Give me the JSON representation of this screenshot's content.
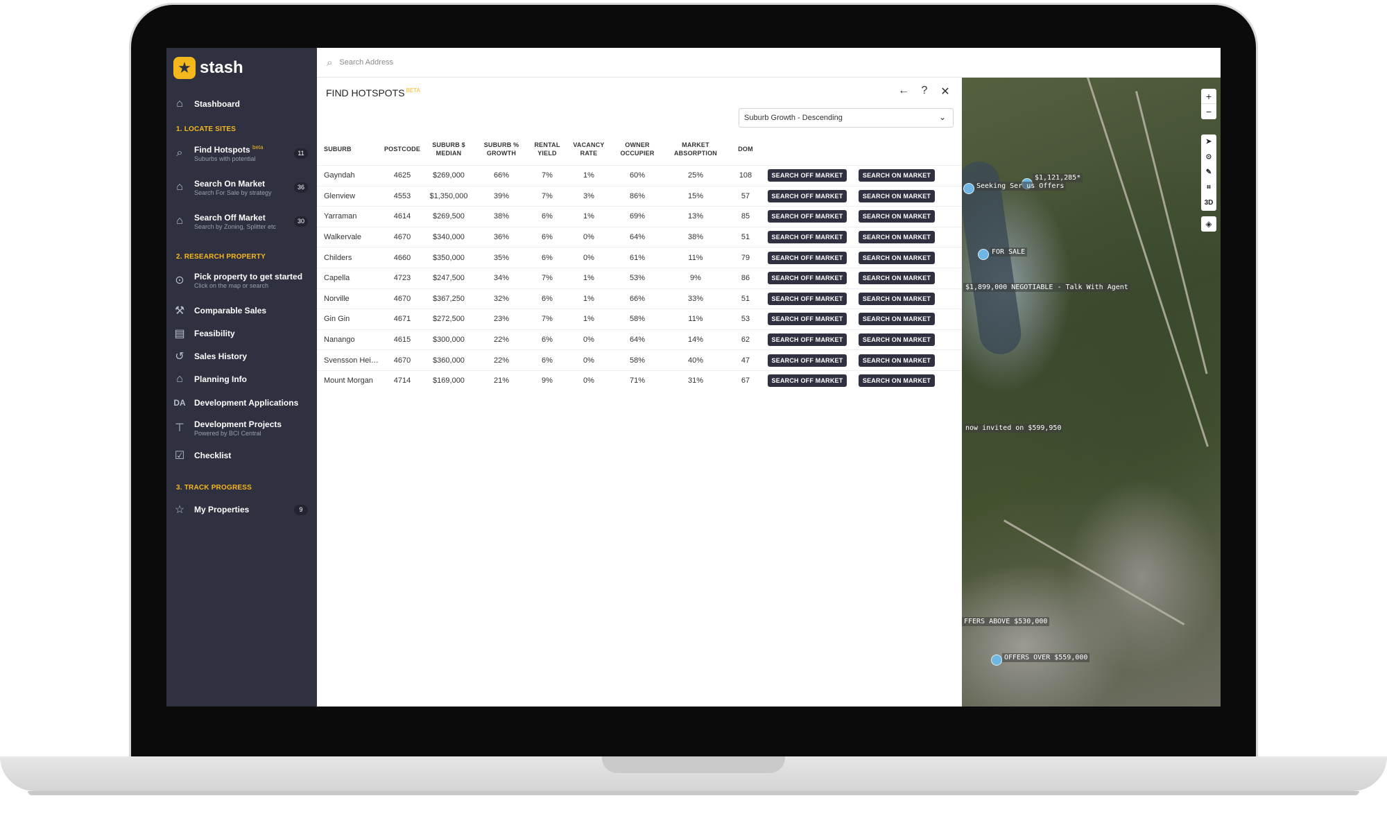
{
  "brand": {
    "name": "stash",
    "logo_icon": "star-icon"
  },
  "sidebar": {
    "stashboard": "Stashboard",
    "sections": [
      "1. LOCATE SITES",
      "2. RESEARCH PROPERTY",
      "3. TRACK PROGRESS"
    ],
    "locate": [
      {
        "label": "Find Hotspots",
        "tag": "beta",
        "sub": "Suburbs with potential",
        "count": "11"
      },
      {
        "label": "Search On Market",
        "sub": "Search For Sale by strategy",
        "count": "36"
      },
      {
        "label": "Search Off Market",
        "sub": "Search by Zoning, Splitter etc",
        "count": "30"
      }
    ],
    "research": [
      {
        "label": "Pick property to get started",
        "sub": "Click on the map or search"
      },
      {
        "label": "Comparable Sales"
      },
      {
        "label": "Feasibility"
      },
      {
        "label": "Sales History"
      },
      {
        "label": "Planning Info"
      },
      {
        "label": "Development Applications",
        "icon_text": "DA"
      },
      {
        "label": "Development Projects",
        "sub": "Powered by BCI Central"
      },
      {
        "label": "Checklist"
      }
    ],
    "track": [
      {
        "label": "My Properties",
        "count": "9"
      }
    ]
  },
  "search": {
    "placeholder": "Search Address"
  },
  "panel": {
    "title": "FIND HOTSPOTS",
    "title_tag": "BETA",
    "sort_value": "Suburb Growth - Descending"
  },
  "table": {
    "headers": [
      "SUBURB",
      "POSTCODE",
      "SUBURB $ MEDIAN",
      "SUBURB % GROWTH",
      "RENTAL YIELD",
      "VACANCY RATE",
      "OWNER OCCUPIER",
      "MARKET ABSORPTION",
      "DOM"
    ],
    "btn_off": "SEARCH OFF MARKET",
    "btn_on": "SEARCH ON MARKET",
    "rows": [
      [
        "Gayndah",
        "4625",
        "$269,000",
        "66%",
        "7%",
        "1%",
        "60%",
        "25%",
        "108"
      ],
      [
        "Glenview",
        "4553",
        "$1,350,000",
        "39%",
        "7%",
        "3%",
        "86%",
        "15%",
        "57"
      ],
      [
        "Yarraman",
        "4614",
        "$269,500",
        "38%",
        "6%",
        "1%",
        "69%",
        "13%",
        "85"
      ],
      [
        "Walkervale",
        "4670",
        "$340,000",
        "36%",
        "6%",
        "0%",
        "64%",
        "38%",
        "51"
      ],
      [
        "Childers",
        "4660",
        "$350,000",
        "35%",
        "6%",
        "0%",
        "61%",
        "11%",
        "79"
      ],
      [
        "Capella",
        "4723",
        "$247,500",
        "34%",
        "7%",
        "1%",
        "53%",
        "9%",
        "86"
      ],
      [
        "Norville",
        "4670",
        "$367,250",
        "32%",
        "6%",
        "1%",
        "66%",
        "33%",
        "51"
      ],
      [
        "Gin Gin",
        "4671",
        "$272,500",
        "23%",
        "7%",
        "1%",
        "58%",
        "11%",
        "53"
      ],
      [
        "Nanango",
        "4615",
        "$300,000",
        "22%",
        "6%",
        "0%",
        "64%",
        "14%",
        "62"
      ],
      [
        "Svensson Heig...",
        "4670",
        "$360,000",
        "22%",
        "6%",
        "0%",
        "58%",
        "40%",
        "47"
      ],
      [
        "Mount Morgan",
        "4714",
        "$169,000",
        "21%",
        "9%",
        "0%",
        "71%",
        "31%",
        "67"
      ]
    ]
  },
  "map": {
    "controls": [
      "+",
      "−"
    ],
    "tools": [
      "pointer-icon",
      "pin-icon",
      "draw-icon",
      "polygon-icon",
      "3D"
    ],
    "labels": [
      "$1,121,285*",
      "Seeking Ser  us Offers",
      "FOR SALE",
      "$1,899,000 NEGOTIABLE - Talk With Agent",
      "now invited on $599,950",
      "FFERS ABOVE $530,000",
      "OFFERS OVER $559,000"
    ]
  },
  "colors": {
    "sidebar_bg": "#2f3141",
    "accent": "#f5b81c",
    "button_bg": "#2f3141",
    "pin": "#6fb6e3"
  }
}
